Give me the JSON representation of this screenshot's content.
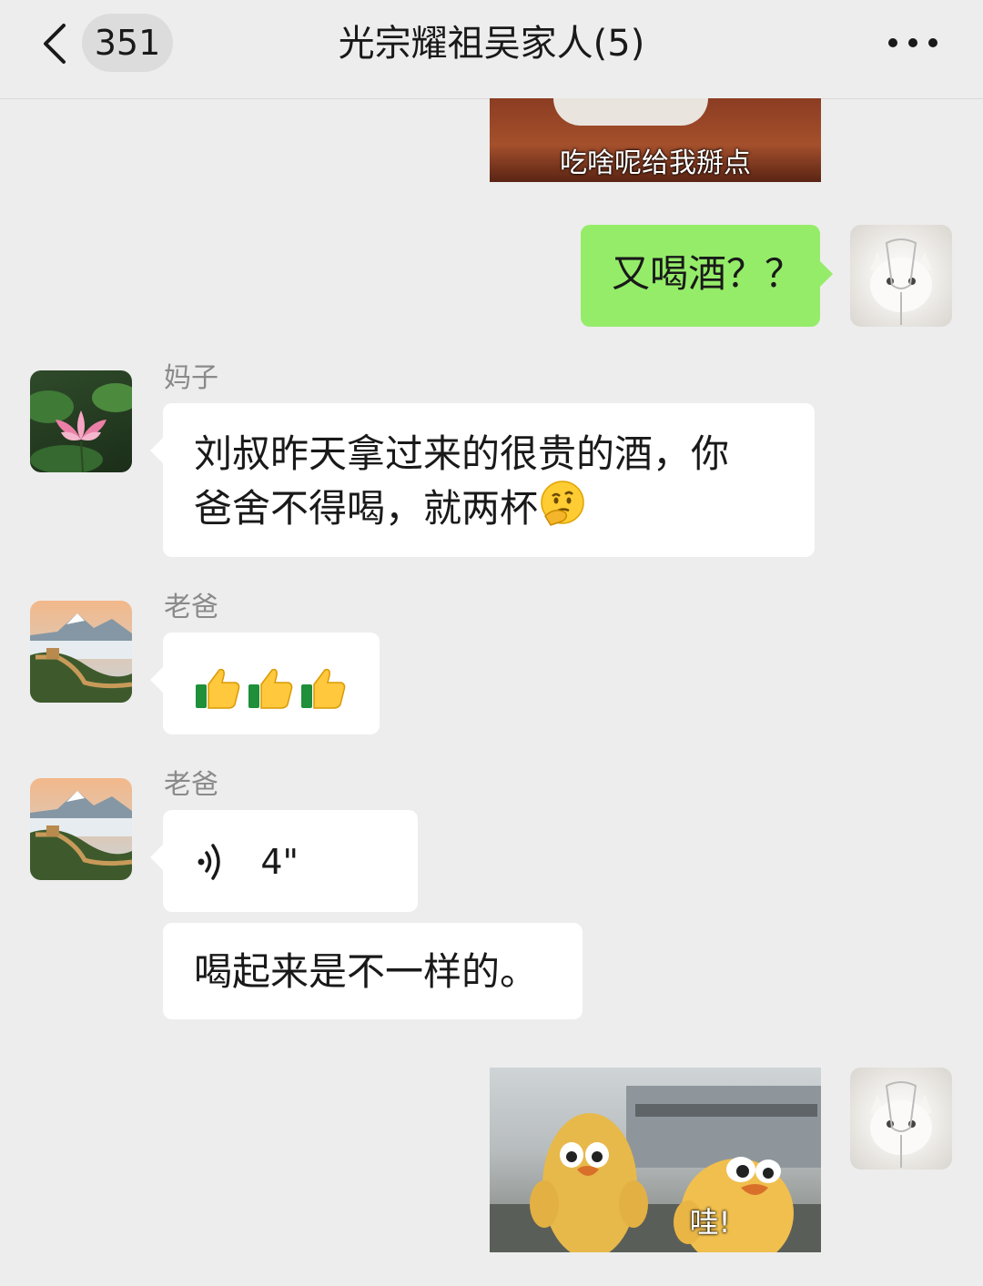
{
  "header": {
    "unread_count": "351",
    "title": "光宗耀祖吴家人(5)"
  },
  "messages": {
    "m1": {
      "caption": "吃啥呢给我掰点"
    },
    "m2": {
      "text": "又喝酒？？"
    },
    "m3": {
      "sender": "妈子",
      "line1": "刘叔昨天拿过来的很贵的酒，你",
      "line2": "爸舍不得喝，就两杯"
    },
    "m4": {
      "sender": "老爸",
      "emoji": "thumbs-up x3"
    },
    "m5": {
      "sender": "老爸",
      "voice_duration": "4\""
    },
    "m6": {
      "text": "喝起来是不一样的。"
    },
    "m7": {
      "caption": "哇!"
    }
  },
  "colors": {
    "self_bubble": "#95ec69",
    "other_bubble": "#ffffff",
    "background": "#ededed"
  }
}
